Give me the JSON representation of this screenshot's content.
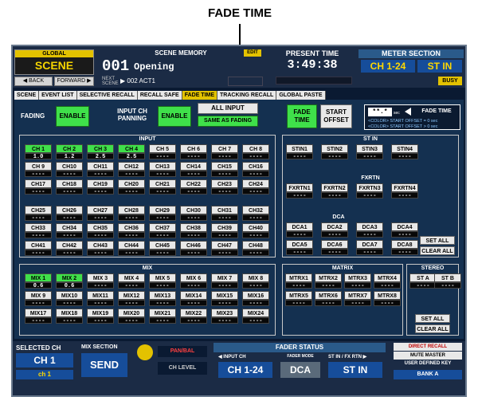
{
  "callout": {
    "title": "FADE TIME"
  },
  "top": {
    "global_label": "GLOBAL",
    "global_value": "SCENE",
    "back": "◀ BACK",
    "forward": "FORWARD ▶",
    "scene_memory_label": "SCENE MEMORY",
    "scene_number": "001",
    "scene_name": "Opening",
    "edit": "EDIT",
    "next_label": "NEXT SCENE",
    "next_value": "▶ 002 ACT1",
    "present_time_label": "PRESENT TIME",
    "present_time": "3:49:38",
    "meter_label": "METER SECTION",
    "meter_1": "CH 1-24",
    "meter_2": "ST IN",
    "busy": "BUSY"
  },
  "tabs": [
    "SCENE",
    "EVENT LIST",
    "SELECTIVE RECALL",
    "RECALL SAFE",
    "FADE TIME",
    "TRACKING RECALL",
    "GLOBAL PASTE"
  ],
  "active_tab": "FADE TIME",
  "fading": {
    "label": "FADING",
    "enable": "ENABLE",
    "panning_label": "INPUT CH PANNING",
    "panning_enable": "ENABLE",
    "all_input": "ALL INPUT",
    "same_as_fading": "SAME AS FADING",
    "fade_time": "FADE TIME",
    "start_offset": "START OFFSET",
    "legend_value": "**.*",
    "legend_unit": "sec",
    "legend_title": "FADE TIME",
    "legend_row1": "<COLOR> START OFFSET = 0 sec",
    "legend_row2": "<COLOR> START OFFSET > 0 sec"
  },
  "input": {
    "title": "INPUT",
    "channels": [
      {
        "n": "CH 1",
        "v": "1.0",
        "on": true
      },
      {
        "n": "CH 2",
        "v": "1.2",
        "on": true
      },
      {
        "n": "CH 3",
        "v": "2.5",
        "on": true
      },
      {
        "n": "CH 4",
        "v": "2.5",
        "on": true
      },
      {
        "n": "CH 5",
        "v": "----",
        "on": false
      },
      {
        "n": "CH 6",
        "v": "----",
        "on": false
      },
      {
        "n": "CH 7",
        "v": "----",
        "on": false
      },
      {
        "n": "CH 8",
        "v": "----",
        "on": false
      },
      {
        "n": "CH 9",
        "v": "----",
        "on": false
      },
      {
        "n": "CH10",
        "v": "----",
        "on": false
      },
      {
        "n": "CH11",
        "v": "----",
        "on": false
      },
      {
        "n": "CH12",
        "v": "----",
        "on": false
      },
      {
        "n": "CH13",
        "v": "----",
        "on": false
      },
      {
        "n": "CH14",
        "v": "----",
        "on": false
      },
      {
        "n": "CH15",
        "v": "----",
        "on": false
      },
      {
        "n": "CH16",
        "v": "----",
        "on": false
      },
      {
        "n": "CH17",
        "v": "----",
        "on": false
      },
      {
        "n": "CH18",
        "v": "----",
        "on": false
      },
      {
        "n": "CH19",
        "v": "----",
        "on": false
      },
      {
        "n": "CH20",
        "v": "----",
        "on": false
      },
      {
        "n": "CH21",
        "v": "----",
        "on": false
      },
      {
        "n": "CH22",
        "v": "----",
        "on": false
      },
      {
        "n": "CH23",
        "v": "----",
        "on": false
      },
      {
        "n": "CH24",
        "v": "----",
        "on": false
      },
      {
        "n": "CH25",
        "v": "----",
        "on": false
      },
      {
        "n": "CH26",
        "v": "----",
        "on": false
      },
      {
        "n": "CH27",
        "v": "----",
        "on": false
      },
      {
        "n": "CH28",
        "v": "----",
        "on": false
      },
      {
        "n": "CH29",
        "v": "----",
        "on": false
      },
      {
        "n": "CH30",
        "v": "----",
        "on": false
      },
      {
        "n": "CH31",
        "v": "----",
        "on": false
      },
      {
        "n": "CH32",
        "v": "----",
        "on": false
      },
      {
        "n": "CH33",
        "v": "----",
        "on": false
      },
      {
        "n": "CH34",
        "v": "----",
        "on": false
      },
      {
        "n": "CH35",
        "v": "----",
        "on": false
      },
      {
        "n": "CH36",
        "v": "----",
        "on": false
      },
      {
        "n": "CH37",
        "v": "----",
        "on": false
      },
      {
        "n": "CH38",
        "v": "----",
        "on": false
      },
      {
        "n": "CH39",
        "v": "----",
        "on": false
      },
      {
        "n": "CH40",
        "v": "----",
        "on": false
      },
      {
        "n": "CH41",
        "v": "----",
        "on": false
      },
      {
        "n": "CH42",
        "v": "----",
        "on": false
      },
      {
        "n": "CH43",
        "v": "----",
        "on": false
      },
      {
        "n": "CH44",
        "v": "----",
        "on": false
      },
      {
        "n": "CH45",
        "v": "----",
        "on": false
      },
      {
        "n": "CH46",
        "v": "----",
        "on": false
      },
      {
        "n": "CH47",
        "v": "----",
        "on": false
      },
      {
        "n": "CH48",
        "v": "----",
        "on": false
      }
    ]
  },
  "stin": {
    "title": "ST IN",
    "channels": [
      {
        "n": "STIN1",
        "v": "----"
      },
      {
        "n": "STIN2",
        "v": "----"
      },
      {
        "n": "STIN3",
        "v": "----"
      },
      {
        "n": "STIN4",
        "v": "----"
      }
    ]
  },
  "fxrtn": {
    "title": "FXRTN",
    "channels": [
      {
        "n": "FXRTN1",
        "v": "----"
      },
      {
        "n": "FXRTN2",
        "v": "----"
      },
      {
        "n": "FXRTN3",
        "v": "----"
      },
      {
        "n": "FXRTN4",
        "v": "----"
      }
    ]
  },
  "dca": {
    "title": "DCA",
    "channels": [
      {
        "n": "DCA1",
        "v": "----"
      },
      {
        "n": "DCA2",
        "v": "----"
      },
      {
        "n": "DCA3",
        "v": "----"
      },
      {
        "n": "DCA4",
        "v": "----"
      },
      {
        "n": "DCA5",
        "v": "----"
      },
      {
        "n": "DCA6",
        "v": "----"
      },
      {
        "n": "DCA7",
        "v": "----"
      },
      {
        "n": "DCA8",
        "v": "----"
      }
    ]
  },
  "set_all": "SET ALL",
  "clear_all": "CLEAR ALL",
  "mix": {
    "title": "MIX",
    "channels": [
      {
        "n": "MIX 1",
        "v": "0.6",
        "on": true
      },
      {
        "n": "MIX 2",
        "v": "0.6",
        "on": true
      },
      {
        "n": "MIX 3",
        "v": "----",
        "on": false
      },
      {
        "n": "MIX 4",
        "v": "----",
        "on": false
      },
      {
        "n": "MIX 5",
        "v": "----",
        "on": false
      },
      {
        "n": "MIX 6",
        "v": "----",
        "on": false
      },
      {
        "n": "MIX 7",
        "v": "----",
        "on": false
      },
      {
        "n": "MIX 8",
        "v": "----",
        "on": false
      },
      {
        "n": "MIX 9",
        "v": "----",
        "on": false
      },
      {
        "n": "MIX10",
        "v": "----",
        "on": false
      },
      {
        "n": "MIX11",
        "v": "----",
        "on": false
      },
      {
        "n": "MIX12",
        "v": "----",
        "on": false
      },
      {
        "n": "MIX13",
        "v": "----",
        "on": false
      },
      {
        "n": "MIX14",
        "v": "----",
        "on": false
      },
      {
        "n": "MIX15",
        "v": "----",
        "on": false
      },
      {
        "n": "MIX16",
        "v": "----",
        "on": false
      },
      {
        "n": "MIX17",
        "v": "----",
        "on": false
      },
      {
        "n": "MIX18",
        "v": "----",
        "on": false
      },
      {
        "n": "MIX19",
        "v": "----",
        "on": false
      },
      {
        "n": "MIX20",
        "v": "----",
        "on": false
      },
      {
        "n": "MIX21",
        "v": "----",
        "on": false
      },
      {
        "n": "MIX22",
        "v": "----",
        "on": false
      },
      {
        "n": "MIX23",
        "v": "----",
        "on": false
      },
      {
        "n": "MIX24",
        "v": "----",
        "on": false
      }
    ]
  },
  "matrix": {
    "title": "MATRIX",
    "channels": [
      {
        "n": "MTRX1",
        "v": "----"
      },
      {
        "n": "MTRX2",
        "v": "----"
      },
      {
        "n": "MTRX3",
        "v": "----"
      },
      {
        "n": "MTRX4",
        "v": "----"
      },
      {
        "n": "MTRX5",
        "v": "----"
      },
      {
        "n": "MTRX6",
        "v": "----"
      },
      {
        "n": "MTRX7",
        "v": "----"
      },
      {
        "n": "MTRX8",
        "v": "----"
      }
    ]
  },
  "stereo": {
    "title": "STEREO",
    "channels": [
      {
        "n": "ST A",
        "v": "----"
      },
      {
        "n": "ST B",
        "v": "----"
      }
    ]
  },
  "bottom": {
    "selected_label": "SELECTED CH",
    "selected_value": "CH 1",
    "selected_sub": "ch 1",
    "mix_section_label": "MIX SECTION",
    "mix_section_value": "SEND",
    "panbal": "PAN/BAL",
    "ch_level": "CH LEVEL",
    "fader_status": "FADER STATUS",
    "input_ch_label": "◀ INPUT CH",
    "input_ch_value": "CH 1-24",
    "fader_mode_label": "FADER MODE",
    "fader_mode_value": "DCA",
    "stin_fxrtn_label": "ST IN / FX RTN ▶",
    "stin_fxrtn_value": "ST IN",
    "direct_recall": "DIRECT RECALL",
    "mute_master": "MUTE MASTER",
    "user_defined_key": "USER DEFINED KEY",
    "bank": "BANK A"
  },
  "colors": {
    "panel": "#143050",
    "enable": "#3fe04a",
    "accent": "#e3c200",
    "meter": "#164d9a"
  }
}
